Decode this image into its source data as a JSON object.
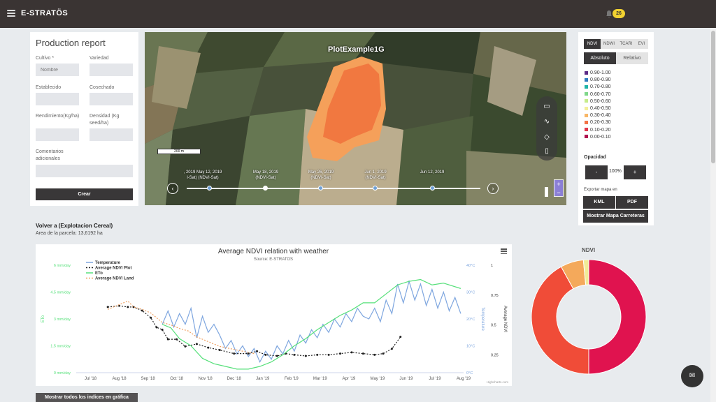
{
  "topbar": {
    "brand": "E-STRATÖS",
    "notifications_count": "26"
  },
  "form": {
    "title": "Production report",
    "cultivo_label": "Cultivo *",
    "cultivo_placeholder": "Nombre",
    "variedad_label": "Variedad",
    "establecido_label": "Establecido",
    "cosechado_label": "Cosechado",
    "rendimiento_label": "Rendimiento(Kg/ha)",
    "densidad_label": "Densidad (Kg seed/ha)",
    "comentarios_label": "Comentarios adicionales",
    "crear_label": "Crear"
  },
  "map": {
    "title": "PlotExample1G",
    "scale_label": "200 m",
    "prev_label": "‹",
    "next_label": "›",
    "zoom_in": "+",
    "zoom_out": "−",
    "timeline": [
      {
        "date": ", 2019 May 12, 2019",
        "source": "l-Sat)  (NDVI-Sat)"
      },
      {
        "date": "May 18, 2019",
        "source": "(NDVI-Sat)"
      },
      {
        "date": "May 26, 2019",
        "source": "(NDVI-Sat)"
      },
      {
        "date": "Jun 1, 2019",
        "source": "(NDVI-Sat)"
      },
      {
        "date": "Jun 12, 2019",
        "source": ""
      }
    ]
  },
  "legend": {
    "tabs": [
      "NDVI",
      "NDWI",
      "TCARI",
      "EVI"
    ],
    "modes": [
      "Absoluto",
      "Relativo"
    ],
    "items": [
      {
        "label": "0.90-1.00",
        "color": "#5b2a86"
      },
      {
        "label": "0.80-0.90",
        "color": "#2f7bbf"
      },
      {
        "label": "0.70-0.80",
        "color": "#1fb4a8"
      },
      {
        "label": "0.60-0.70",
        "color": "#7fd78a"
      },
      {
        "label": "0.50-0.60",
        "color": "#c6ec8b"
      },
      {
        "label": "0.40-0.50",
        "color": "#f4ef9a"
      },
      {
        "label": "0.30-0.40",
        "color": "#f8b767"
      },
      {
        "label": "0.20-0.30",
        "color": "#f37346"
      },
      {
        "label": "0.10-0.20",
        "color": "#e0354c"
      },
      {
        "label": "0.00-0.10",
        "color": "#b0124f"
      }
    ],
    "opacity_label": "Opacidad",
    "opacity_minus": "-",
    "opacity_value": "100%",
    "opacity_plus": "+",
    "export_label": "Exportar mapa en",
    "kml_label": "KML",
    "pdf_label": "PDF",
    "carreteras_label": "Mostrar Mapa Carreteras"
  },
  "plot": {
    "title": "Volver a (Explotacion Cereal)",
    "area": "Area de la parcela: 13,6192 ha"
  },
  "chart_data": {
    "type": "line",
    "title": "Average NDVI relation with weather",
    "subtitle": "Source: E-STRATOS",
    "credit": "Highcharts.com",
    "x_ticks": [
      "Jul '18",
      "Aug '18",
      "Sep '18",
      "Oct '18",
      "Nov '18",
      "Dec '18",
      "Jan '19",
      "Feb '19",
      "Mar '19",
      "Apr '19",
      "May '19",
      "Jun '19",
      "Jul '19",
      "Aug '19"
    ],
    "axes": {
      "eto": {
        "label": "ETo",
        "ticks": [
          "0 mm/day",
          "1.5 mm/day",
          "3 mm/day",
          "4.5 mm/day",
          "6 mm/day"
        ],
        "range": [
          0,
          6
        ]
      },
      "temperature": {
        "label": "Temperature",
        "ticks": [
          "0°C",
          "10°C",
          "20°C",
          "30°C",
          "40°C"
        ],
        "range": [
          0,
          40
        ]
      },
      "ndvi": {
        "label": "Average NDVI",
        "ticks": [
          "0.25",
          "0.5",
          "0.75",
          "1"
        ],
        "range": [
          0.1,
          1
        ]
      }
    },
    "series": [
      {
        "name": "Temperature",
        "axis": "temperature",
        "color": "#7ea6df",
        "x": [
          3.0,
          3.2,
          3.4,
          3.6,
          3.8,
          4.0,
          4.2,
          4.4,
          4.6,
          4.8,
          5.0,
          5.2,
          5.4,
          5.6,
          5.8,
          6.0,
          6.2,
          6.4,
          6.6,
          6.8,
          7.0,
          7.2,
          7.4,
          7.6,
          7.8,
          8.0,
          8.2,
          8.4,
          8.6,
          8.8,
          9.0,
          9.2,
          9.4,
          9.6,
          9.8,
          10.0,
          10.2,
          10.4,
          10.6,
          10.8,
          11.0,
          11.2,
          11.4,
          11.6,
          11.8,
          12.0,
          12.2,
          12.4,
          12.6,
          12.8,
          13.0,
          13.2,
          13.4
        ],
        "values": [
          18,
          23,
          17,
          22,
          18,
          24,
          13,
          21,
          15,
          18,
          14,
          9,
          12,
          7,
          10,
          6,
          9,
          4,
          8,
          5,
          10,
          7,
          12,
          8,
          14,
          11,
          16,
          13,
          18,
          15,
          20,
          17,
          22,
          19,
          24,
          21,
          20,
          24,
          19,
          27,
          22,
          33,
          26,
          34,
          27,
          33,
          25,
          31,
          24,
          30,
          23,
          28,
          22
        ]
      },
      {
        "name": "Average NDVI Plot",
        "axis": "ndvi",
        "color": "#222222",
        "x": [
          1.1,
          1.5,
          1.8,
          2.0,
          2.3,
          2.6,
          2.8,
          3.0,
          3.2,
          3.5,
          3.8,
          4.2,
          4.6,
          5.0,
          5.5,
          6.0,
          6.3,
          6.6,
          7.0,
          7.3,
          7.6,
          8.0,
          8.4,
          8.8,
          9.2,
          9.6,
          10.0,
          10.4,
          10.7,
          11.0,
          11.3
        ],
        "values": [
          0.65,
          0.66,
          0.65,
          0.65,
          0.62,
          0.56,
          0.48,
          0.46,
          0.38,
          0.38,
          0.32,
          0.34,
          0.31,
          0.29,
          0.26,
          0.26,
          0.28,
          0.25,
          0.24,
          0.26,
          0.25,
          0.24,
          0.25,
          0.25,
          0.26,
          0.27,
          0.26,
          0.25,
          0.26,
          0.3,
          0.4
        ]
      },
      {
        "name": "ETo",
        "axis": "eto",
        "color": "#56e07a",
        "x": [
          3.0,
          3.3,
          3.6,
          4.0,
          4.4,
          4.8,
          5.2,
          5.6,
          6.0,
          6.4,
          6.8,
          7.2,
          7.6,
          8.0,
          8.4,
          8.8,
          9.2,
          9.6,
          10.0,
          10.4,
          10.8,
          11.2,
          11.6,
          12.0,
          12.4,
          12.8,
          13.4
        ],
        "values": [
          2.7,
          2.5,
          1.9,
          1.5,
          0.8,
          0.5,
          0.35,
          0.2,
          0.2,
          0.35,
          0.6,
          1.0,
          1.5,
          1.9,
          2.4,
          2.8,
          3.2,
          3.5,
          3.9,
          3.9,
          4.4,
          4.9,
          5.1,
          5.2,
          4.9,
          5.0,
          4.7
        ]
      },
      {
        "name": "Average NDVI Land",
        "axis": "ndvi",
        "color": "#f0a060",
        "x": [
          1.1,
          1.4,
          1.8,
          2.0,
          2.3,
          2.6,
          2.8,
          3.0,
          3.3,
          3.6,
          3.9,
          4.2,
          4.6,
          5.0,
          5.4,
          5.8,
          6.2
        ],
        "values": [
          0.63,
          0.66,
          0.7,
          0.65,
          0.63,
          0.6,
          0.56,
          0.52,
          0.5,
          0.47,
          0.45,
          0.4,
          0.36,
          0.32,
          0.3,
          0.28,
          0.26
        ]
      }
    ]
  },
  "donut": {
    "title": "NDVI",
    "slices": [
      {
        "value": 0.5,
        "color": "#e0134f"
      },
      {
        "value": 0.42,
        "color": "#f04c38"
      },
      {
        "value": 0.065,
        "color": "#f4a95b"
      },
      {
        "value": 0.015,
        "color": "#f1ec96"
      }
    ]
  },
  "buttons": {
    "chat_icon": "✉",
    "show_all": "Mostrar todos los indices en gráfica"
  }
}
